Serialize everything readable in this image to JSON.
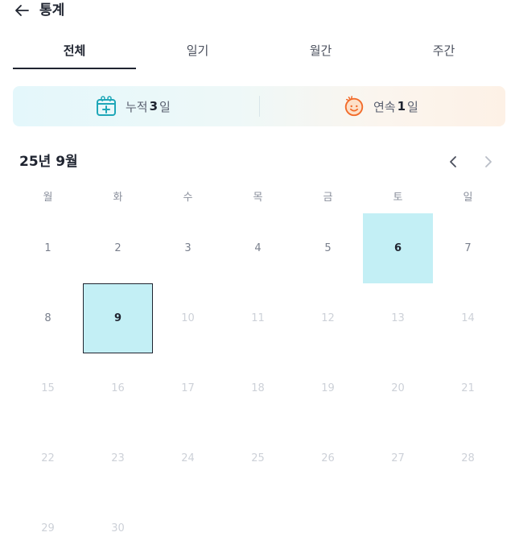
{
  "header": {
    "title": "통계",
    "back_icon": "arrow-left-icon"
  },
  "tabs": [
    {
      "label": "전체",
      "active": true
    },
    {
      "label": "일기",
      "active": false
    },
    {
      "label": "월간",
      "active": false
    },
    {
      "label": "주간",
      "active": false
    }
  ],
  "summary": {
    "total": {
      "prefix": "누적",
      "value": "3",
      "suffix": "일",
      "icon": "calendar-add-icon",
      "color": "#1ea7b8"
    },
    "streak": {
      "prefix": "연속",
      "value": "1",
      "suffix": "일",
      "icon": "smile-face-icon",
      "color": "#f26b2a"
    }
  },
  "calendar": {
    "month_label": "25년 9월",
    "weekdays": [
      "월",
      "화",
      "수",
      "목",
      "금",
      "토",
      "일"
    ],
    "days": [
      {
        "n": "1",
        "state": "past"
      },
      {
        "n": "2",
        "state": "past"
      },
      {
        "n": "3",
        "state": "past"
      },
      {
        "n": "4",
        "state": "past"
      },
      {
        "n": "5",
        "state": "past"
      },
      {
        "n": "6",
        "state": "filled"
      },
      {
        "n": "7",
        "state": "past"
      },
      {
        "n": "8",
        "state": "past"
      },
      {
        "n": "9",
        "state": "today"
      },
      {
        "n": "10",
        "state": "future"
      },
      {
        "n": "11",
        "state": "future"
      },
      {
        "n": "12",
        "state": "future"
      },
      {
        "n": "13",
        "state": "future"
      },
      {
        "n": "14",
        "state": "future"
      },
      {
        "n": "15",
        "state": "future"
      },
      {
        "n": "16",
        "state": "future"
      },
      {
        "n": "17",
        "state": "future"
      },
      {
        "n": "18",
        "state": "future"
      },
      {
        "n": "19",
        "state": "future"
      },
      {
        "n": "20",
        "state": "future"
      },
      {
        "n": "21",
        "state": "future"
      },
      {
        "n": "22",
        "state": "future"
      },
      {
        "n": "23",
        "state": "future"
      },
      {
        "n": "24",
        "state": "future"
      },
      {
        "n": "25",
        "state": "future"
      },
      {
        "n": "26",
        "state": "future"
      },
      {
        "n": "27",
        "state": "future"
      },
      {
        "n": "28",
        "state": "future"
      },
      {
        "n": "29",
        "state": "future"
      },
      {
        "n": "30",
        "state": "future"
      }
    ],
    "highlight_color": "#c3eff5"
  }
}
